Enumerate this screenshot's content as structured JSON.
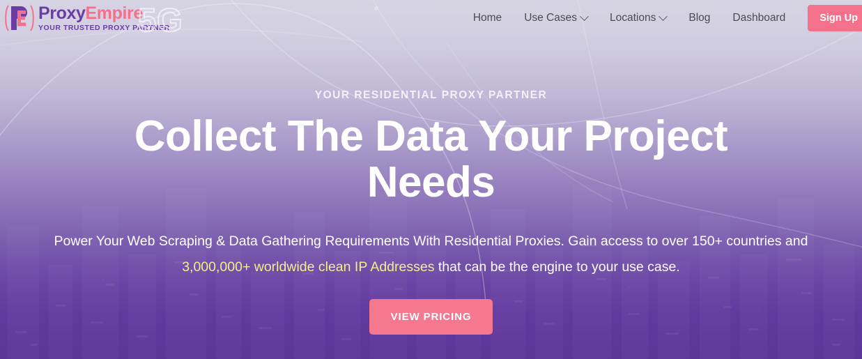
{
  "header": {
    "logo": {
      "word_primary": "Proxy",
      "word_secondary": "Empire",
      "tagline": "YOUR TRUSTED PROXY PARTNER",
      "watermark": "5G",
      "mark_letters": "PE"
    },
    "nav_items": [
      {
        "label": "Home",
        "has_dropdown": false
      },
      {
        "label": "Use Cases",
        "has_dropdown": true
      },
      {
        "label": "Locations",
        "has_dropdown": true
      },
      {
        "label": "Blog",
        "has_dropdown": false
      },
      {
        "label": "Dashboard",
        "has_dropdown": false
      }
    ],
    "signup_label": "Sign Up"
  },
  "hero": {
    "eyebrow": "YOUR RESIDENTIAL PROXY PARTNER",
    "headline": "Collect The Data Your Project Needs",
    "subhead_part1": "Power Your Web Scraping & Data Gathering Requirements With Residential Proxies. Gain access to over 150+ countries and ",
    "subhead_highlight": "3,000,000+ worldwide clean IP Addresses",
    "subhead_part2": " that can be the engine to your use case.",
    "cta_label": "VIEW PRICING"
  },
  "colors": {
    "brand_purple": "#6b3da3",
    "brand_pink": "#f4718c",
    "cta_pink": "#f4788f",
    "highlight_yellow": "#f2ef8a",
    "header_bg": "#d6d3e3",
    "hero_bottom": "#5e3499"
  }
}
